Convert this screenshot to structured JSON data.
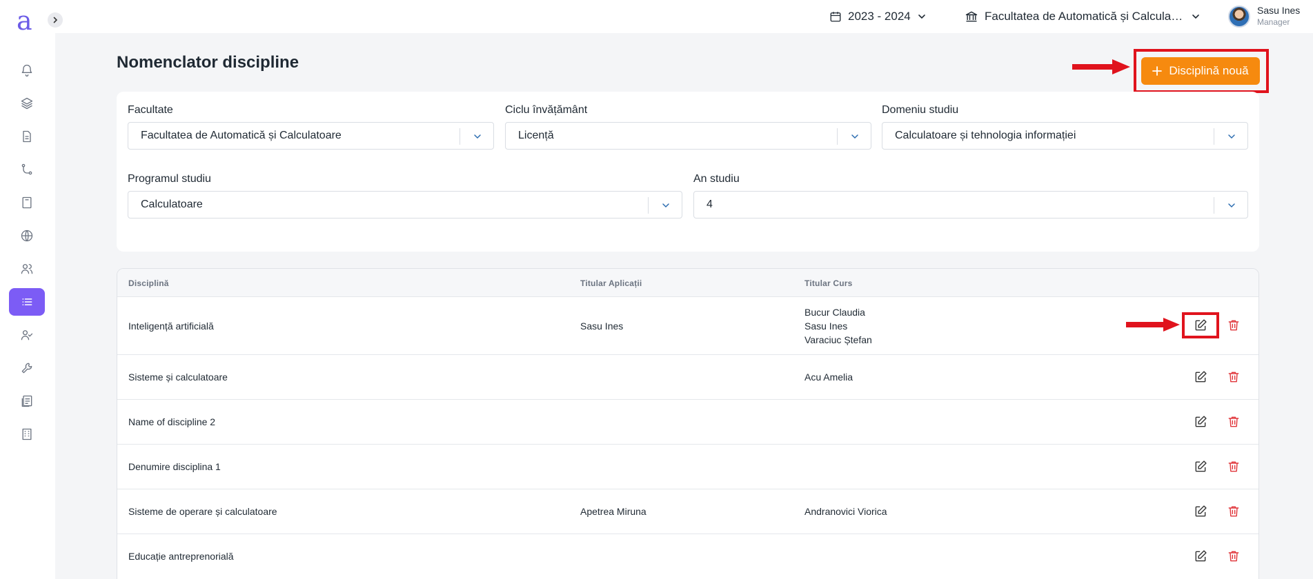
{
  "app": {
    "logo_text": "a"
  },
  "sidebar": {
    "items": [
      {
        "icon": "bell-icon"
      },
      {
        "icon": "layers-icon"
      },
      {
        "icon": "document-icon"
      },
      {
        "icon": "workflow-icon"
      },
      {
        "icon": "book-icon"
      },
      {
        "icon": "globe-icon"
      },
      {
        "icon": "users-icon"
      },
      {
        "icon": "list-icon",
        "active": true
      },
      {
        "icon": "user-check-icon"
      },
      {
        "icon": "wrench-icon"
      },
      {
        "icon": "reports-icon"
      },
      {
        "icon": "building-icon"
      }
    ]
  },
  "topbar": {
    "year": "2023 - 2024",
    "faculty": "Facultatea de Automatică și Calculatoare",
    "user_name": "Sasu Ines",
    "user_role": "Manager"
  },
  "page": {
    "title": "Nomenclator discipline",
    "add_button": "Disciplină nouă"
  },
  "filters": {
    "facultate": {
      "label": "Facultate",
      "value": "Facultatea de Automatică și Calculatoare"
    },
    "ciclu": {
      "label": "Ciclu învățământ",
      "value": "Licență"
    },
    "domeniu": {
      "label": "Domeniu studiu",
      "value": "Calculatoare și tehnologia informației"
    },
    "program": {
      "label": "Programul studiu",
      "value": "Calculatoare"
    },
    "an": {
      "label": "An studiu",
      "value": "4"
    }
  },
  "table": {
    "headers": [
      "Disciplină",
      "Titular Aplicații",
      "Titular Curs"
    ],
    "rows": [
      {
        "disciplina": "Inteligență artificială",
        "titular_aplicatii": "Sasu Ines",
        "titular_curs": [
          "Bucur Claudia",
          "Sasu Ines",
          "Varaciuc Ștefan"
        ]
      },
      {
        "disciplina": "Sisteme și calculatoare",
        "titular_aplicatii": "",
        "titular_curs": [
          "Acu Amelia"
        ]
      },
      {
        "disciplina": "Name of discipline 2",
        "titular_aplicatii": "",
        "titular_curs": []
      },
      {
        "disciplina": "Denumire disciplina 1",
        "titular_aplicatii": "",
        "titular_curs": []
      },
      {
        "disciplina": "Sisteme de operare și calculatoare",
        "titular_aplicatii": "Apetrea Miruna",
        "titular_curs": [
          "Andranovici Viorica"
        ]
      },
      {
        "disciplina": "Educație antreprenorială",
        "titular_aplicatii": "",
        "titular_curs": []
      }
    ]
  },
  "colors": {
    "accent": "#7c5cf5",
    "primary_button": "#f68a0f",
    "highlight": "#e0131d",
    "delete": "#e0353a"
  }
}
